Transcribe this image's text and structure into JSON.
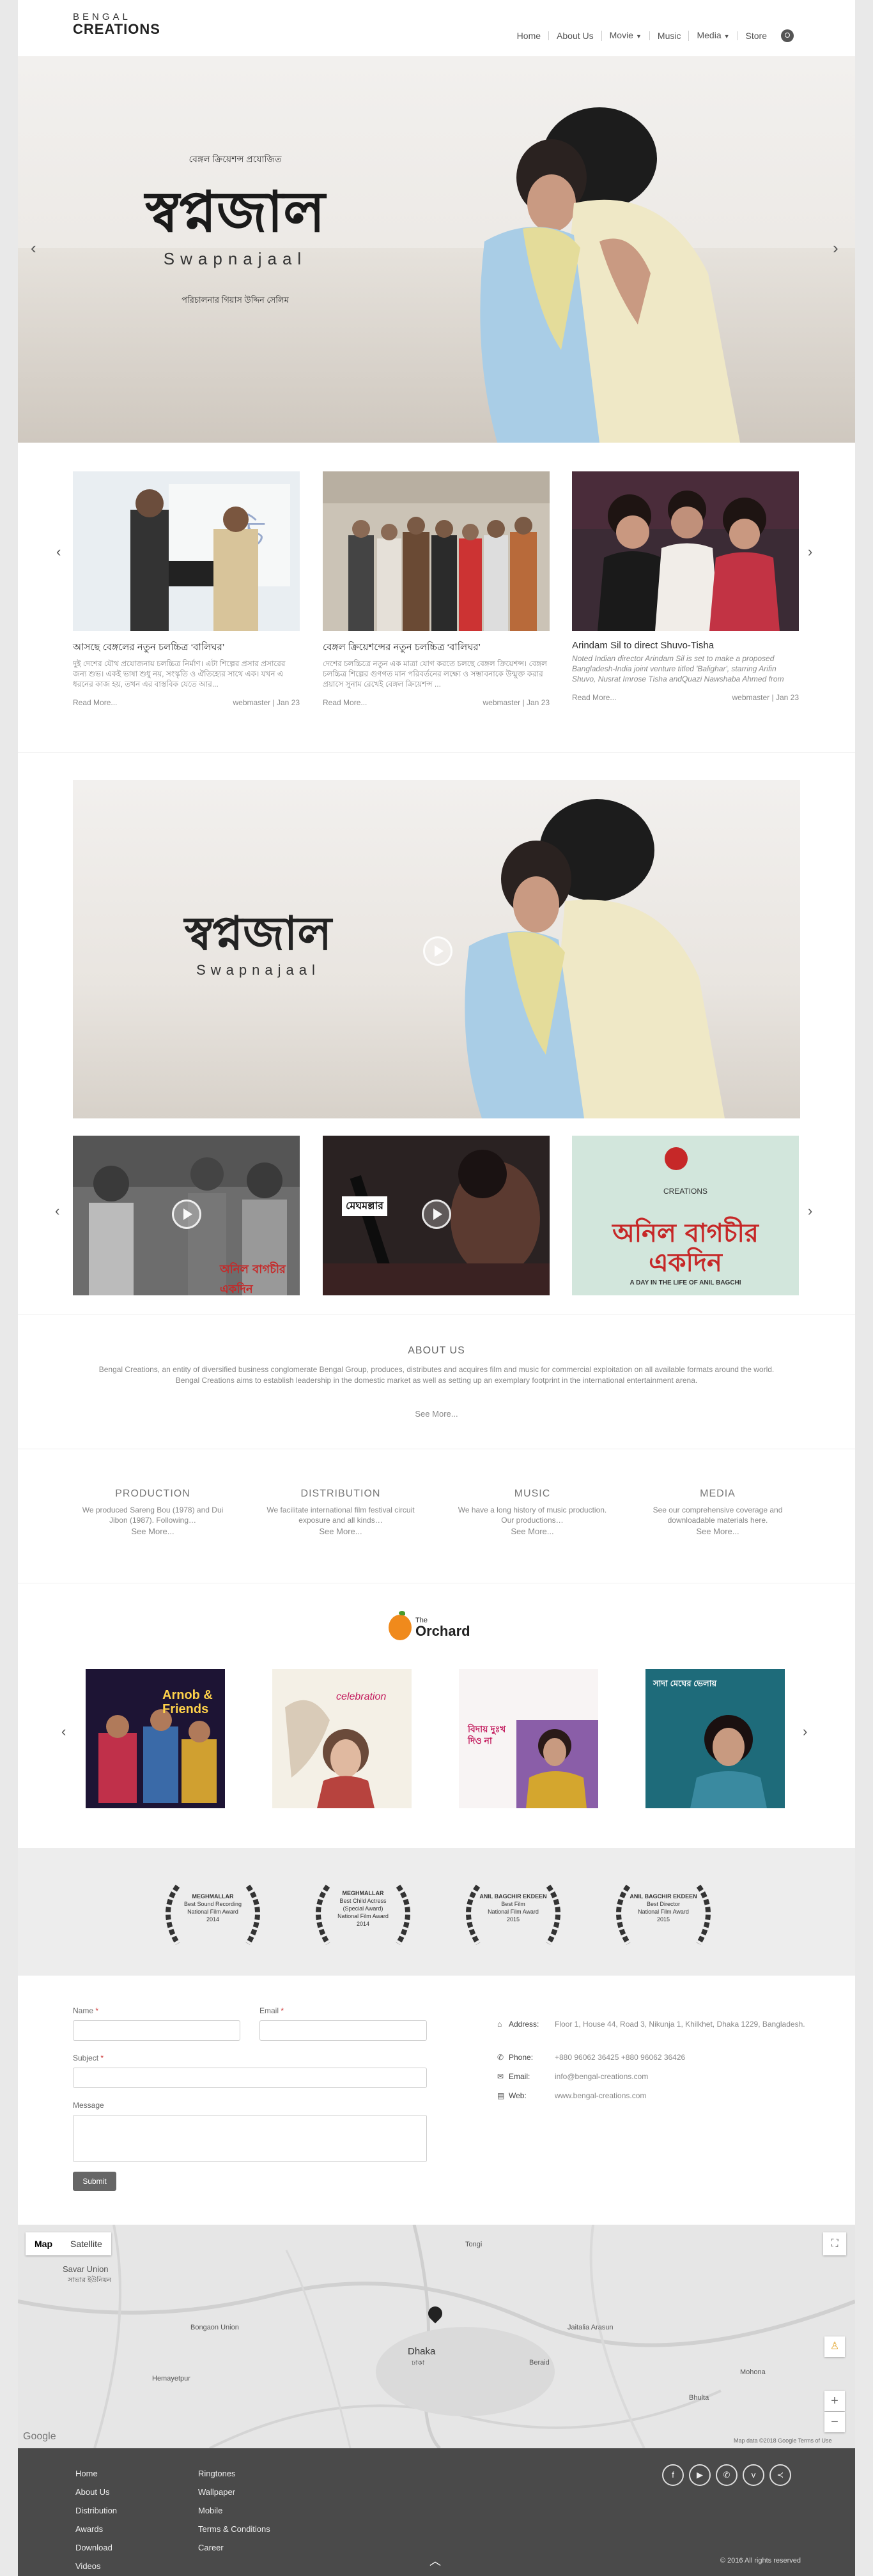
{
  "header": {
    "logo_top": "BENGAL",
    "logo_bottom": "CREATIONS",
    "nav": [
      "Home",
      "About Us",
      "Movie",
      "Music",
      "Media",
      "Store"
    ]
  },
  "hero": {
    "presents": "বেঙ্গল ক্রিয়েশন্স প্রযোজিত",
    "title_bn": "স্বপ্নজাল",
    "title_en": "Swapnajaal",
    "credit": "পরিচালনার গিয়াস উদ্দিন সেলিম"
  },
  "news": [
    {
      "title": "আসছে বেঙ্গলের নতুন চলচ্চিত্র ‘বালিঘর’",
      "excerpt": "দুই দেশের যৌথ প্রযোজনায় চলচ্চিত্র নির্মাণ। এটা শিল্পের প্রসার প্রসারের জন্য শুভ। একই ভাষা শুধু নয়, সংস্কৃতি ও ঐতিহ্যের সাথে এক। যখন এ ধরনের কাজ হয়, তখন এর বাস্তবিক যেতে আর...",
      "author": "webmaster",
      "date": "Jan 23",
      "more": "Read More..."
    },
    {
      "title": "বেঙ্গল ক্রিয়েশন্সের নতুন চলচ্চিত্র ‘বালিঘর’",
      "excerpt": "দেশের চলচ্চিত্রে নতুন এক মাত্রা যোগ করতে চলছে বেঙ্গল ক্রিয়েশন্স। বেঙ্গল চলচ্চিত্র শিল্পের গুণগত মান পরিবর্তনের লক্ষ্যে ও সম্ভাবনাকে উন্মুক্ত করার প্রয়াসে সুনাম রেখেই বেঙ্গল ক্রিয়েশন্স ...",
      "author": "webmaster",
      "date": "Jan 23",
      "more": "Read More..."
    },
    {
      "title": "Arindam Sil to direct Shuvo-Tisha",
      "excerpt": "Noted Indian director Arindam Sil is set to make a proposed Bangladesh-India joint venture titled 'Balighar', starring Arifin Shuvo, Nusrat Imrose Tisha andQuazi Nawshaba Ahmed from Bangladesh...",
      "author": "webmaster",
      "date": "Jan 23",
      "more": "Read More..."
    }
  ],
  "video": {
    "title_bn": "স্বপ্নজাল",
    "title_en": "Swapnajaal",
    "thumb2_bn": "মেঘমল্লার",
    "thumb3_bn": "অনিল বাগচীর একদিন",
    "thumb3_en": "A DAY IN THE LIFE OF ANIL BAGCHI",
    "thumb1_bn": "অনিল বাগচীর একদিন"
  },
  "about": {
    "heading": "ABOUT US",
    "text": "Bengal Creations, an entity of diversified business conglomerate Bengal Group, produces, distributes and acquires film and music for commercial exploitation on all available formats around the world. Bengal Creations aims to establish leadership in the domestic market as well as setting up an exemplary footprint in the international entertainment arena.",
    "more": "See More..."
  },
  "services": [
    {
      "title": "PRODUCTION",
      "text": "We produced Sareng Bou (1978) and Dui Jibon (1987). Following…",
      "more": "See More..."
    },
    {
      "title": "DISTRIBUTION",
      "text": "We facilitate international film festival circuit exposure and all kinds…",
      "more": "See More..."
    },
    {
      "title": "MUSIC",
      "text": "We have a long history of music production. Our productions…",
      "more": "See More..."
    },
    {
      "title": "MEDIA",
      "text": "See our comprehensive coverage and downloadable materials here.",
      "more": "See More..."
    }
  ],
  "music": {
    "brand_top": "The",
    "brand": "Orchard",
    "albums": [
      {
        "title": "Arnob & Friends"
      },
      {
        "title": "celebration"
      },
      {
        "title": "বিদায় দুঃখ দিও না"
      },
      {
        "title": "সাদা মেঘের ভেলায়"
      }
    ]
  },
  "awards": [
    {
      "org": "MEGHMALLAR",
      "line1": "Best Sound Recording",
      "line2": "National Film Award",
      "year": "2014"
    },
    {
      "org": "MEGHMALLAR",
      "line1": "Best Child Actress",
      "line2": "(Special Award)",
      "line3": "National Film Award",
      "year": "2014"
    },
    {
      "org": "ANIL BAGCHIR EKDEEN",
      "line1": "Best Film",
      "line2": "National Film Award",
      "year": "2015"
    },
    {
      "org": "ANIL BAGCHIR EKDEEN",
      "line1": "Best Director",
      "line2": "National Film Award",
      "year": "2015"
    }
  ],
  "contact": {
    "name_label": "Name",
    "email_label": "Email",
    "subject_label": "Subject",
    "message_label": "Message",
    "required": "*",
    "submit": "Submit",
    "address_label": "Address:",
    "address": "Floor 1, House 44, Road 3, Nikunja 1, Khilkhet, Dhaka 1229, Bangladesh.",
    "phone_label": "Phone:",
    "phone": "+880 96062 36425  +880 96062 36426",
    "email_info_label": "Email:",
    "email_info": "info@bengal-creations.com",
    "web_label": "Web:",
    "web": "www.bengal-creations.com"
  },
  "map": {
    "tab_map": "Map",
    "tab_satellite": "Satellite",
    "labels": [
      "Savar Union",
      "সাভার ইউনিয়ন",
      "Bongaon Union",
      "Hemayetpur",
      "Dhaka",
      "ঢাকা",
      "Jaitalia Arasun",
      "Mohona",
      "Beraid",
      "Bhulta",
      "Tongi"
    ],
    "attribution": "Map data ©2018 Google   Terms of Use",
    "google": "Google"
  },
  "footer": {
    "col1": [
      "Home",
      "About Us",
      "Distribution",
      "Awards",
      "Download",
      "Videos"
    ],
    "col2": [
      "Ringtones",
      "Wallpaper",
      "Mobile",
      "Terms & Conditions",
      "Career"
    ],
    "copyright": "© 2016 All rights reserved"
  }
}
